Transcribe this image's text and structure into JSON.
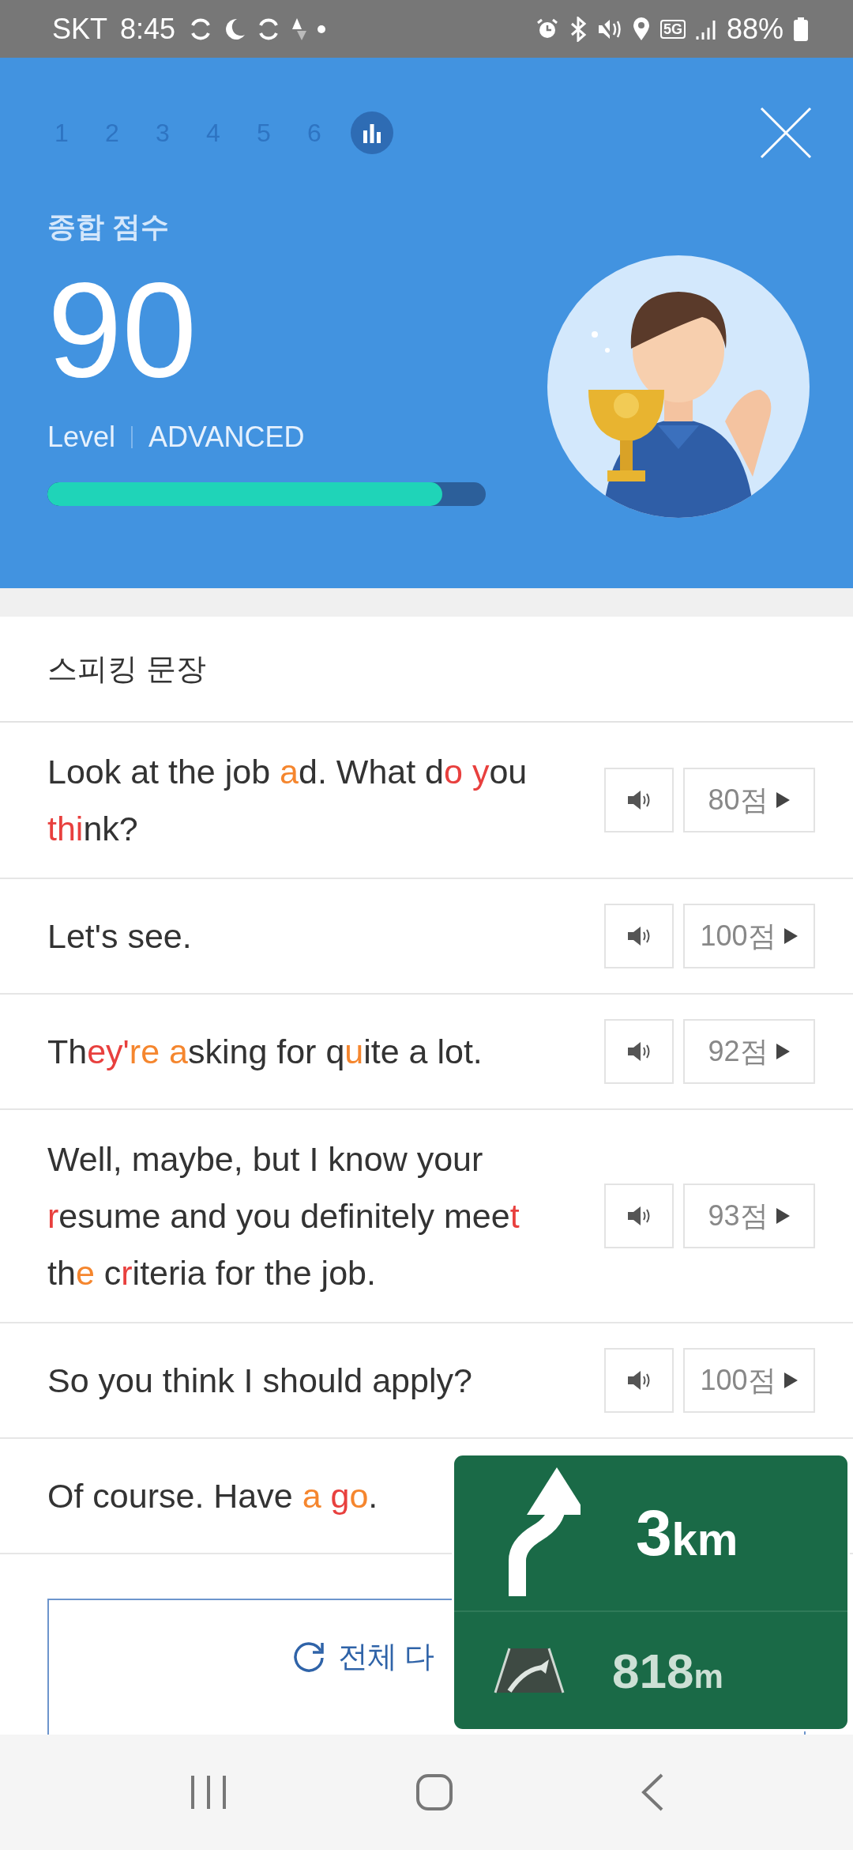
{
  "status_bar": {
    "carrier": "SKT",
    "time": "8:45",
    "network": "5G",
    "battery": "88%"
  },
  "steps": [
    {
      "kind": "number",
      "label": "1",
      "selected": false
    },
    {
      "kind": "number",
      "label": "2",
      "selected": false
    },
    {
      "kind": "number",
      "label": "3",
      "selected": false
    },
    {
      "kind": "number",
      "label": "4",
      "selected": false
    },
    {
      "kind": "number",
      "label": "5",
      "selected": false
    },
    {
      "kind": "number",
      "label": "6",
      "selected": false
    },
    {
      "kind": "chart",
      "selected": true
    }
  ],
  "score": {
    "title": "종합 점수",
    "value": "90",
    "level_label": "Level",
    "level_name": "ADVANCED",
    "level": 0.9
  },
  "section_title": "스피킹 문장",
  "sentences": [
    {
      "segments": [
        {
          "text": "Look at the job "
        },
        {
          "text": "a",
          "color": "#f5862e"
        },
        {
          "text": "d. What d"
        },
        {
          "text": "o ",
          "color": "#e8403e"
        },
        {
          "text": "y",
          "color": "#e8403e"
        },
        {
          "text": "ou "
        },
        {
          "text": "thi",
          "color": "#e8403e"
        },
        {
          "text": "nk?"
        }
      ],
      "score": "80점"
    },
    {
      "segments": [
        {
          "text": "Let's see."
        }
      ],
      "score": "100점"
    },
    {
      "segments": [
        {
          "text": "Th"
        },
        {
          "text": "ey'",
          "color": "#e8403e"
        },
        {
          "text": "re ",
          "color": "#f5862e"
        },
        {
          "text": "a",
          "color": "#f5862e"
        },
        {
          "text": "sking for q"
        },
        {
          "text": "u",
          "color": "#f5862e"
        },
        {
          "text": "ite a lot."
        }
      ],
      "score": "92점"
    },
    {
      "segments": [
        {
          "text": "Well, maybe, but I know your "
        },
        {
          "text": "r",
          "color": "#e8403e"
        },
        {
          "text": "esume and you definitely mee"
        },
        {
          "text": "t",
          "color": "#e8403e"
        },
        {
          "text": " th"
        },
        {
          "text": "e",
          "color": "#f5862e"
        },
        {
          "text": " c"
        },
        {
          "text": "r",
          "color": "#e8403e"
        },
        {
          "text": "iteria for the job."
        }
      ],
      "score": "93점"
    },
    {
      "segments": [
        {
          "text": "So you think I should apply?"
        }
      ],
      "score": "100점"
    },
    {
      "segments": [
        {
          "text": "Of course. Have "
        },
        {
          "text": "a ",
          "color": "#f5862e"
        },
        {
          "text": "g",
          "color": "#e8403e"
        },
        {
          "text": "o",
          "color": "#f5862e"
        },
        {
          "text": "."
        }
      ]
    }
  ],
  "retry_button": "전체 다",
  "navigation_popup": {
    "distance": "3",
    "distance_unit": "km",
    "next_distance": "818",
    "next_unit": "m"
  }
}
